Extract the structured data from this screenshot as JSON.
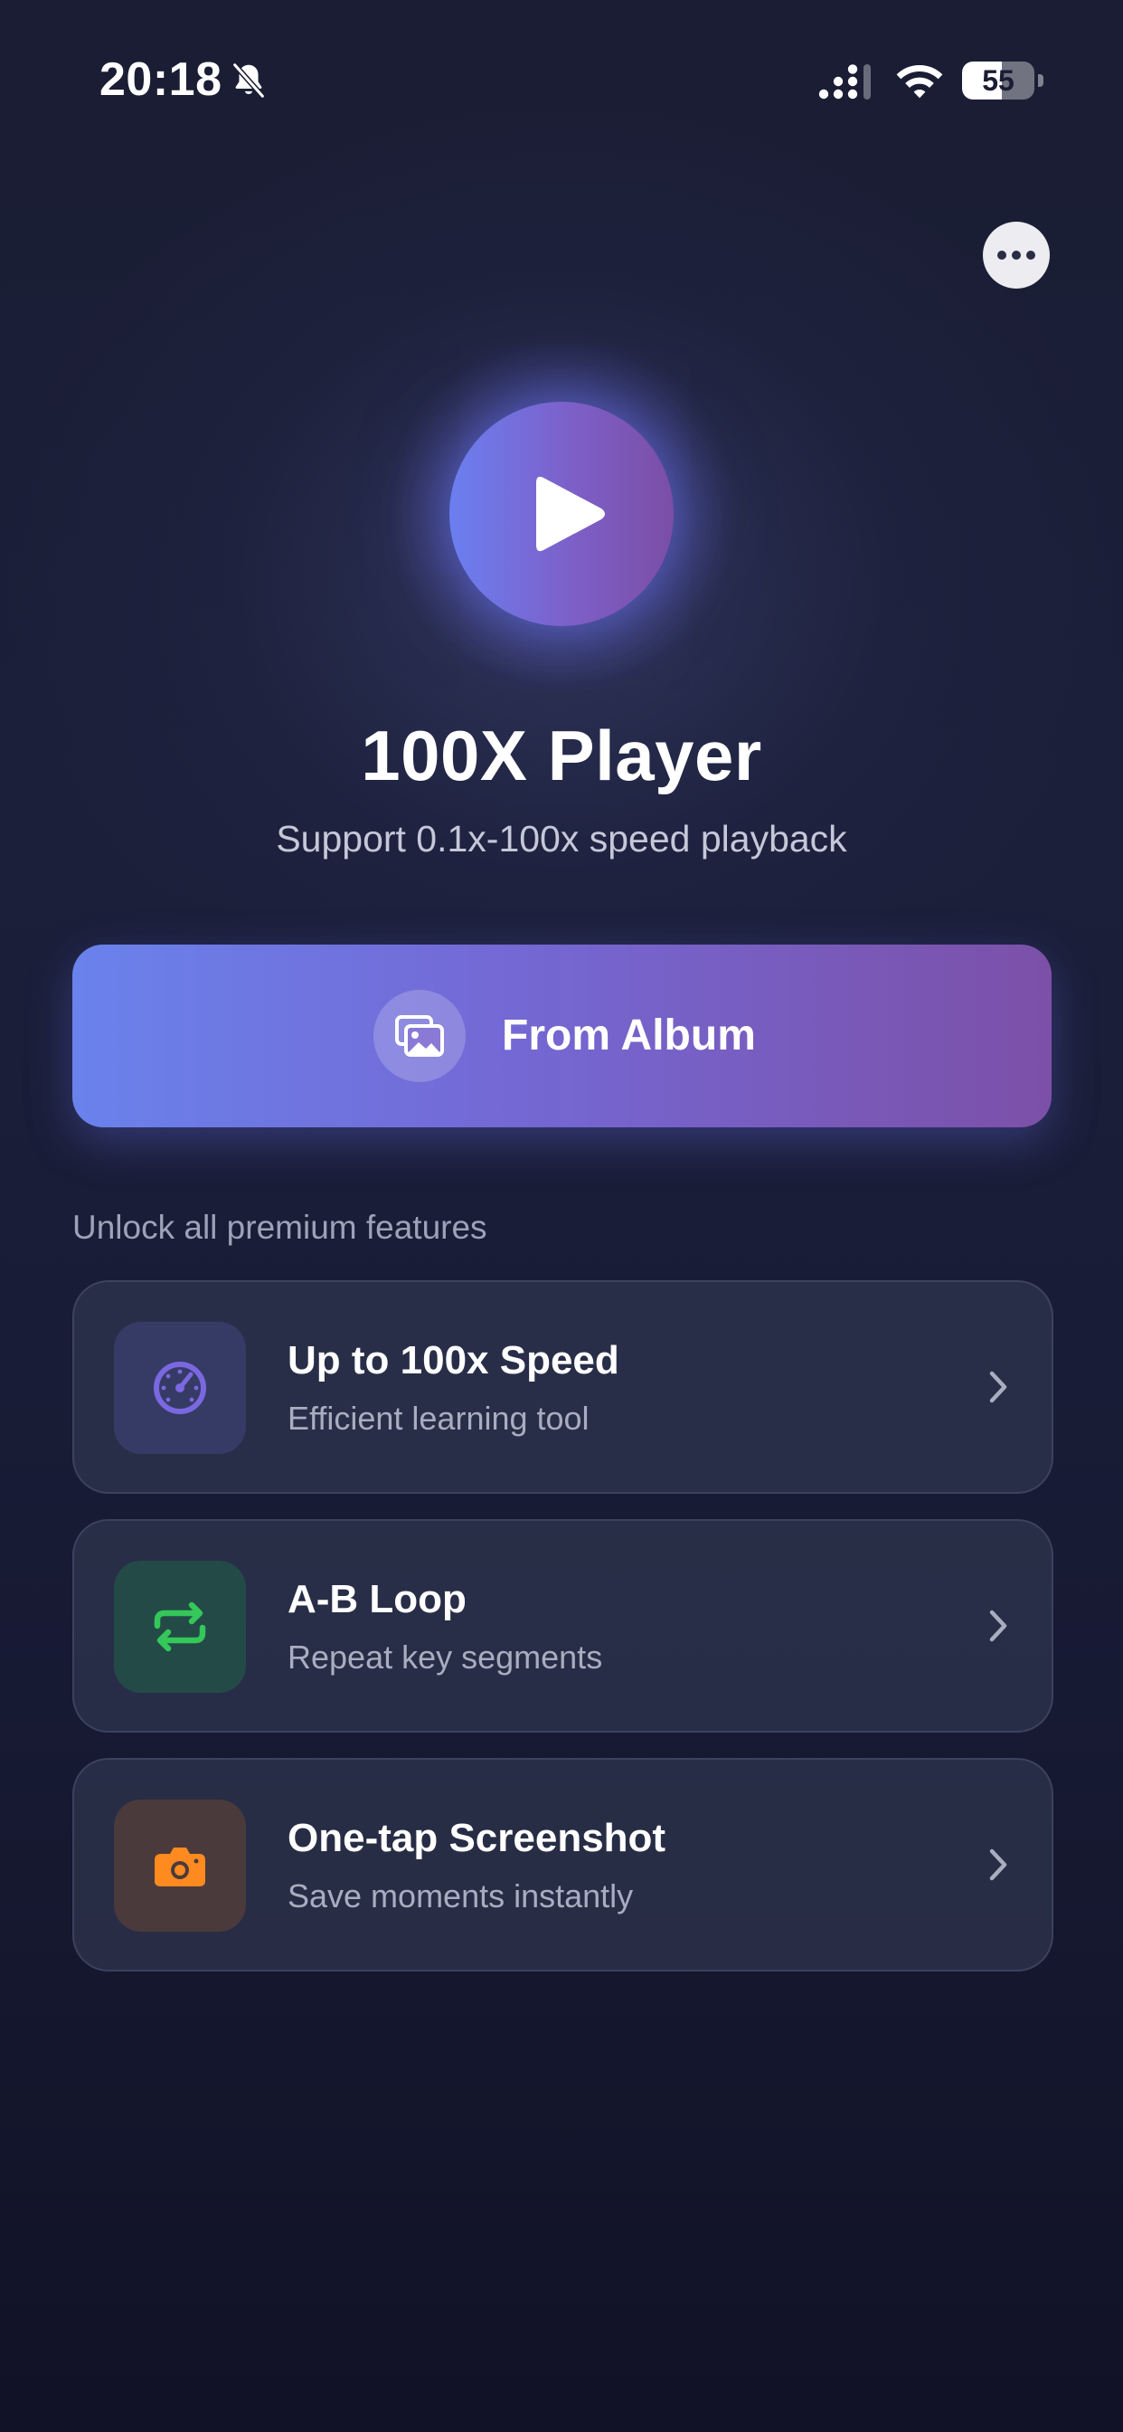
{
  "status_bar": {
    "time": "20:18",
    "battery_level": "55",
    "battery_fraction": 0.55,
    "icons": [
      "bell-slash-icon",
      "signal-icon",
      "wifi-icon",
      "battery-icon"
    ]
  },
  "header": {
    "more_icon": "ellipsis-icon"
  },
  "hero": {
    "icon": "play-icon",
    "title": "100X Player",
    "subtitle": "Support 0.1x-100x speed playback"
  },
  "album_button": {
    "label": "From Album",
    "icon": "photos-icon"
  },
  "premium": {
    "section_label": "Unlock all premium features",
    "features": [
      {
        "title": "Up to 100x Speed",
        "description": "Efficient learning tool",
        "icon": "speedometer-icon",
        "icon_color": "#7b68e0",
        "icon_bg": "#363b66"
      },
      {
        "title": "A-B Loop",
        "description": "Repeat key segments",
        "icon": "repeat-icon",
        "icon_color": "#34c759",
        "icon_bg": "#244a48"
      },
      {
        "title": "One-tap Screenshot",
        "description": "Save moments instantly",
        "icon": "camera-icon",
        "icon_color": "#ff8a1f",
        "icon_bg": "#4a3a3c"
      }
    ]
  },
  "colors": {
    "background_top": "#1a1d33",
    "background_bottom": "#111227",
    "accent_start": "#6a82ec",
    "accent_end": "#7c50a8"
  }
}
